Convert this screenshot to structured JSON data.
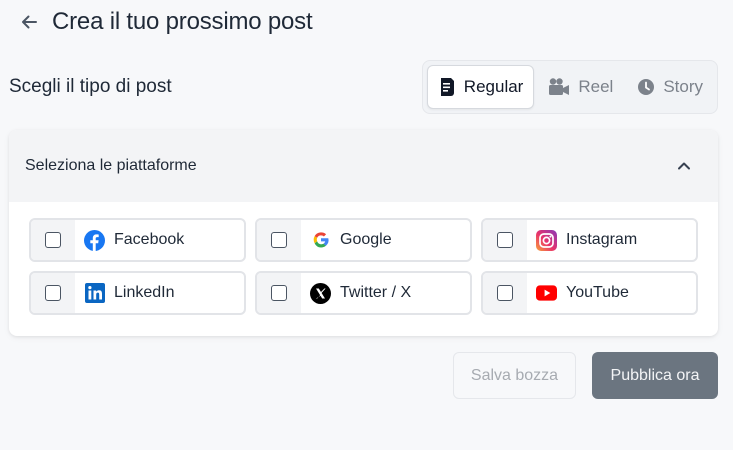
{
  "header": {
    "title": "Crea il tuo prossimo post"
  },
  "post_type": {
    "label": "Scegli il tipo di post",
    "options": [
      {
        "label": "Regular",
        "icon": "document-icon",
        "active": true
      },
      {
        "label": "Reel",
        "icon": "video-camera-icon",
        "active": false
      },
      {
        "label": "Story",
        "icon": "clock-icon",
        "active": false
      }
    ]
  },
  "platforms": {
    "title": "Seleziona le piattaforme",
    "collapse_icon": "chevron-up-icon",
    "items": [
      {
        "label": "Facebook",
        "icon": "facebook-icon",
        "checked": false
      },
      {
        "label": "Google",
        "icon": "google-icon",
        "checked": false
      },
      {
        "label": "Instagram",
        "icon": "instagram-icon",
        "checked": false
      },
      {
        "label": "LinkedIn",
        "icon": "linkedin-icon",
        "checked": false
      },
      {
        "label": "Twitter / X",
        "icon": "x-icon",
        "checked": false
      },
      {
        "label": "YouTube",
        "icon": "youtube-icon",
        "checked": false
      }
    ]
  },
  "actions": {
    "draft_label": "Salva bozza",
    "publish_label": "Pubblica ora"
  },
  "colors": {
    "primary_button": "#6b7580",
    "background": "#f7f8fa"
  }
}
